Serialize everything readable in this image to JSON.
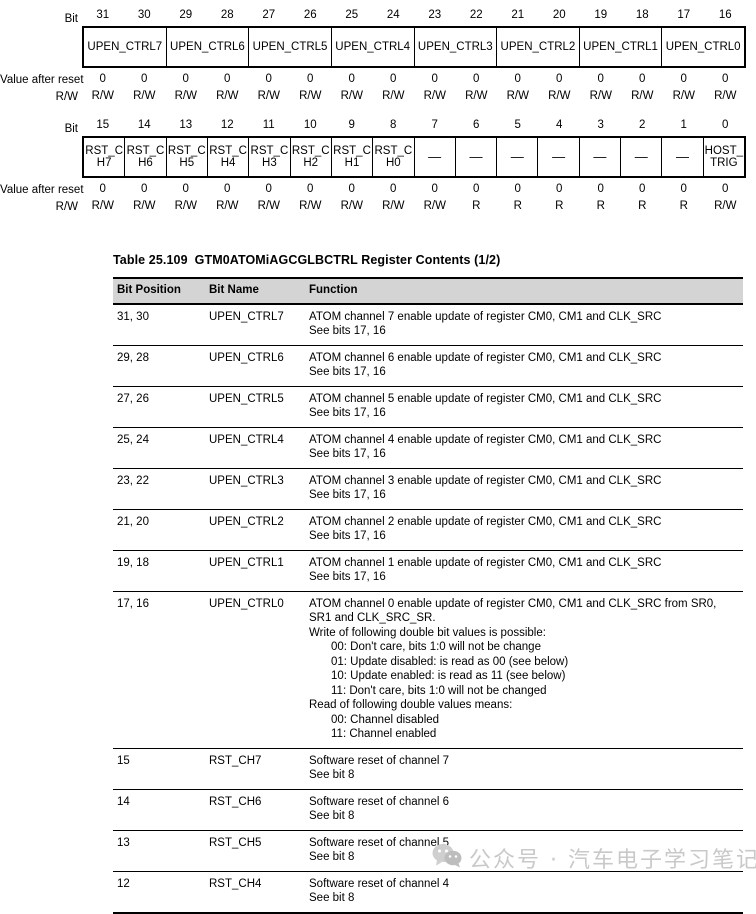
{
  "register_high": {
    "bit_label": "Bit",
    "value_label": "Value after reset",
    "rw_label": "R/W",
    "bit_numbers": [
      "31",
      "30",
      "29",
      "28",
      "27",
      "26",
      "25",
      "24",
      "23",
      "22",
      "21",
      "20",
      "19",
      "18",
      "17",
      "16"
    ],
    "fields": [
      {
        "name": "UPEN_CTRL7",
        "span": 2
      },
      {
        "name": "UPEN_CTRL6",
        "span": 2
      },
      {
        "name": "UPEN_CTRL5",
        "span": 2
      },
      {
        "name": "UPEN_CTRL4",
        "span": 2
      },
      {
        "name": "UPEN_CTRL3",
        "span": 2
      },
      {
        "name": "UPEN_CTRL2",
        "span": 2
      },
      {
        "name": "UPEN_CTRL1",
        "span": 2
      },
      {
        "name": "UPEN_CTRL0",
        "span": 2
      }
    ],
    "reset_values": [
      "0",
      "0",
      "0",
      "0",
      "0",
      "0",
      "0",
      "0",
      "0",
      "0",
      "0",
      "0",
      "0",
      "0",
      "0",
      "0"
    ],
    "access": [
      "R/W",
      "R/W",
      "R/W",
      "R/W",
      "R/W",
      "R/W",
      "R/W",
      "R/W",
      "R/W",
      "R/W",
      "R/W",
      "R/W",
      "R/W",
      "R/W",
      "R/W",
      "R/W"
    ]
  },
  "register_low": {
    "bit_label": "Bit",
    "value_label": "Value after reset",
    "rw_label": "R/W",
    "bit_numbers": [
      "15",
      "14",
      "13",
      "12",
      "11",
      "10",
      "9",
      "8",
      "7",
      "6",
      "5",
      "4",
      "3",
      "2",
      "1",
      "0"
    ],
    "fields": [
      {
        "name": "RST_CH7",
        "span": 1
      },
      {
        "name": "RST_CH6",
        "span": 1
      },
      {
        "name": "RST_CH5",
        "span": 1
      },
      {
        "name": "RST_CH4",
        "span": 1
      },
      {
        "name": "RST_CH3",
        "span": 1
      },
      {
        "name": "RST_CH2",
        "span": 1
      },
      {
        "name": "RST_CH1",
        "span": 1
      },
      {
        "name": "RST_CH0",
        "span": 1
      },
      {
        "name": "—",
        "span": 1
      },
      {
        "name": "—",
        "span": 1
      },
      {
        "name": "—",
        "span": 1
      },
      {
        "name": "—",
        "span": 1
      },
      {
        "name": "—",
        "span": 1
      },
      {
        "name": "—",
        "span": 1
      },
      {
        "name": "—",
        "span": 1
      },
      {
        "name": "HOST_TRIG",
        "span": 1
      }
    ],
    "reset_values": [
      "0",
      "0",
      "0",
      "0",
      "0",
      "0",
      "0",
      "0",
      "0",
      "0",
      "0",
      "0",
      "0",
      "0",
      "0",
      "0"
    ],
    "access": [
      "R/W",
      "R/W",
      "R/W",
      "R/W",
      "R/W",
      "R/W",
      "R/W",
      "R/W",
      "R/W",
      "R",
      "R",
      "R",
      "R",
      "R",
      "R",
      "R/W"
    ]
  },
  "table": {
    "caption_number": "Table 25.109",
    "caption_text": "GTM0ATOMiAGCGLBCTRL Register Contents (1/2)",
    "headers": [
      "Bit Position",
      "Bit Name",
      "Function"
    ],
    "rows": [
      {
        "bit_position": "31, 30",
        "bit_name": "UPEN_CTRL7",
        "function": [
          {
            "text": "ATOM channel 7 enable update of register CM0, CM1 and CLK_SRC",
            "indent": false
          },
          {
            "text": "See bits 17, 16",
            "indent": false
          }
        ]
      },
      {
        "bit_position": "29, 28",
        "bit_name": "UPEN_CTRL6",
        "function": [
          {
            "text": "ATOM channel 6 enable update of register CM0, CM1 and CLK_SRC",
            "indent": false
          },
          {
            "text": "See bits 17, 16",
            "indent": false
          }
        ]
      },
      {
        "bit_position": "27, 26",
        "bit_name": "UPEN_CTRL5",
        "function": [
          {
            "text": "ATOM channel 5 enable update of register CM0, CM1 and CLK_SRC",
            "indent": false
          },
          {
            "text": "See bits 17, 16",
            "indent": false
          }
        ]
      },
      {
        "bit_position": "25, 24",
        "bit_name": "UPEN_CTRL4",
        "function": [
          {
            "text": "ATOM channel 4 enable update of register CM0, CM1 and CLK_SRC",
            "indent": false
          },
          {
            "text": "See bits 17, 16",
            "indent": false
          }
        ]
      },
      {
        "bit_position": "23, 22",
        "bit_name": "UPEN_CTRL3",
        "function": [
          {
            "text": "ATOM channel 3 enable update of register CM0, CM1 and CLK_SRC",
            "indent": false
          },
          {
            "text": "See bits 17, 16",
            "indent": false
          }
        ]
      },
      {
        "bit_position": "21, 20",
        "bit_name": "UPEN_CTRL2",
        "function": [
          {
            "text": "ATOM channel 2 enable update of register CM0, CM1 and CLK_SRC",
            "indent": false
          },
          {
            "text": "See bits 17, 16",
            "indent": false
          }
        ]
      },
      {
        "bit_position": "19, 18",
        "bit_name": "UPEN_CTRL1",
        "function": [
          {
            "text": "ATOM channel 1 enable update of register CM0, CM1 and CLK_SRC",
            "indent": false
          },
          {
            "text": "See bits 17, 16",
            "indent": false
          }
        ]
      },
      {
        "bit_position": "17, 16",
        "bit_name": "UPEN_CTRL0",
        "function": [
          {
            "text": "ATOM channel 0 enable update of register CM0, CM1 and CLK_SRC from SR0,",
            "indent": false
          },
          {
            "text": "SR1 and CLK_SRC_SR.",
            "indent": false
          },
          {
            "text": "Write of following double bit values is possible:",
            "indent": false
          },
          {
            "text": "00: Don't care, bits 1:0 will not be change",
            "indent": true
          },
          {
            "text": "01: Update disabled: is read as 00 (see below)",
            "indent": true
          },
          {
            "text": "10: Update enabled: is read as 11 (see below)",
            "indent": true
          },
          {
            "text": "11: Don't care, bits 1:0 will not be changed",
            "indent": true
          },
          {
            "text": "Read of following double values means:",
            "indent": false
          },
          {
            "text": "00: Channel disabled",
            "indent": true
          },
          {
            "text": "11: Channel enabled",
            "indent": true
          }
        ]
      },
      {
        "bit_position": "15",
        "bit_name": "RST_CH7",
        "function": [
          {
            "text": "Software reset of channel 7",
            "indent": false
          },
          {
            "text": "See bit 8",
            "indent": false
          }
        ]
      },
      {
        "bit_position": "14",
        "bit_name": "RST_CH6",
        "function": [
          {
            "text": "Software reset of channel 6",
            "indent": false
          },
          {
            "text": "See bit 8",
            "indent": false
          }
        ]
      },
      {
        "bit_position": "13",
        "bit_name": "RST_CH5",
        "function": [
          {
            "text": "Software reset of channel 5",
            "indent": false
          },
          {
            "text": "See bit 8",
            "indent": false
          }
        ]
      },
      {
        "bit_position": "12",
        "bit_name": "RST_CH4",
        "function": [
          {
            "text": "Software reset of channel 4",
            "indent": false
          },
          {
            "text": "See bit 8",
            "indent": false
          }
        ]
      }
    ]
  },
  "watermark": {
    "text": "公众号 · 汽车电子学习笔记",
    "color": "#c9c9c9"
  }
}
